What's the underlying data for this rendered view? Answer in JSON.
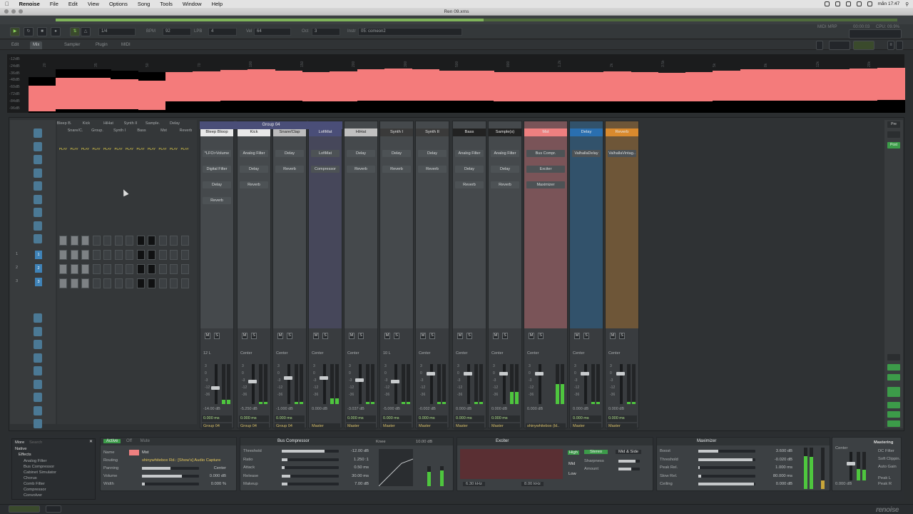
{
  "menu": {
    "app": "Renoise",
    "items": [
      "File",
      "Edit",
      "View",
      "Options",
      "Song",
      "Tools",
      "Window",
      "Help"
    ],
    "clock": "mån 17:47"
  },
  "window": {
    "title": "Ren 09.xrns"
  },
  "transport": {
    "pattern_step": "1/4",
    "bpm_label": "BPM",
    "bpm": "92",
    "lpb_label": "LPB",
    "lpb": "4",
    "vel_label": "Vel",
    "vel": "64",
    "oct_label": "Oct",
    "oct": "3",
    "instr_label": "Instr",
    "instr": "05: comeon2",
    "midi_label": "MIDI MRP",
    "time": "00:00:03",
    "cpu": "CPU: 09.9%"
  },
  "tabs": [
    {
      "label": "Edit"
    },
    {
      "label": "Mix"
    },
    {
      "label": "Sampler"
    },
    {
      "label": "Plugin"
    },
    {
      "label": "MIDI"
    }
  ],
  "spectrum": {
    "db_labels": [
      "-12dB",
      "-24dB",
      "-36dB",
      "-48dB",
      "-60dB",
      "-72dB",
      "-84dB",
      "-96dB"
    ],
    "freq_labels": [
      "20",
      "35",
      "50",
      "70",
      "100",
      "150",
      "200",
      "300",
      "500",
      "800",
      "1.2k",
      "2k",
      "3.5k",
      "5k",
      "8k",
      "12k",
      "20k"
    ],
    "levels": [
      0.78,
      0.52,
      0.52,
      0.56,
      0.62,
      0.6,
      0.58,
      0.53,
      0.5,
      0.55,
      0.6,
      0.58,
      0.52,
      0.49,
      0.5,
      0.55,
      0.57,
      0.6,
      0.62,
      0.6,
      0.62,
      0.58,
      0.61,
      0.64,
      0.62,
      0.56,
      0.5,
      0.52,
      0.5,
      0.52,
      0.49,
      0.47
    ]
  },
  "matrix": {
    "tracks": [
      "Bleep B.",
      "Snare/C.",
      "Kick",
      "Group.",
      "HiHat",
      "Synth I",
      "Synth II",
      "Bass",
      "Sample.",
      "Mst",
      "Delay",
      "Reverb"
    ],
    "play": "PLAY",
    "rows": [
      "1",
      "2",
      "3"
    ]
  },
  "strips": [
    {
      "name": "Group 04",
      "color": "#4a4e78",
      "fx": [],
      "pan": "",
      "vol": "",
      "route": ""
    },
    {
      "name": "Bleep Bloop",
      "color": "#e8e8e8",
      "fx": [
        "*LFO>Volume",
        "Digital Filter",
        "Delay",
        "Reverb"
      ],
      "pan": "12 L",
      "vol": "-14.00 dB",
      "route": "Group 04",
      "lat": "0.000 ms",
      "meter": 0.1,
      "fader": 0.55
    },
    {
      "name": "Kick",
      "color": "#e8e8e8",
      "fx": [
        "Analog Filter",
        "Delay",
        "Reverb"
      ],
      "pan": "Center",
      "vol": "-5.250 dB",
      "route": "Group 04",
      "lat": "0.000 ms",
      "meter": 0.05,
      "fader": 0.4
    },
    {
      "name": "Snare/Clap",
      "color": "#bcbcbc",
      "fx": [
        "Delay",
        "Reverb"
      ],
      "pan": "Center",
      "vol": "-1.000 dB",
      "route": "Group 04",
      "lat": "0.000 ms",
      "meter": 0.05,
      "fader": 0.3
    },
    {
      "name": "LofiMat",
      "color": "#4a4e78",
      "fx": [
        "LofiMat",
        "Compressor"
      ],
      "pan": "Center",
      "vol": "0.000 dB",
      "route": "Master",
      "lat": "",
      "meter": 0.15,
      "fader": 0.3
    },
    {
      "name": "HiHat",
      "color": "#c0c0c0",
      "fx": [
        "Delay",
        "Reverb"
      ],
      "pan": "Center",
      "vol": "-3.037 dB",
      "route": "Master",
      "lat": "0.000 ms",
      "meter": 0.05,
      "fader": 0.35
    },
    {
      "name": "Synth I",
      "color": "#3a3a3a",
      "fx": [
        "Delay",
        "Reverb"
      ],
      "pan": "10 L",
      "vol": "-5.000 dB",
      "route": "Master",
      "lat": "0.000 ms",
      "meter": 0.05,
      "fader": 0.4
    },
    {
      "name": "Synth II",
      "color": "#3a3a3a",
      "fx": [
        "Delay",
        "Reverb"
      ],
      "pan": "Center",
      "vol": "-0.002 dB",
      "route": "Master",
      "lat": "0.000 ms",
      "meter": 0.05,
      "fader": 0.2
    },
    {
      "name": "Bass",
      "color": "#222",
      "fx": [
        "Analog Filter",
        "Delay",
        "Reverb"
      ],
      "pan": "Center",
      "vol": "0.000 dB",
      "route": "Master",
      "lat": "0.000 ms",
      "meter": 0.05,
      "fader": 0.2
    },
    {
      "name": "Sample(s)",
      "color": "#222",
      "fx": [
        "Analog Filter",
        "Delay",
        "Reverb"
      ],
      "pan": "Center",
      "vol": "0.000 dB",
      "route": "Master",
      "lat": "0.000 ms",
      "meter": 0.3,
      "fader": 0.2
    },
    {
      "name": "Mst",
      "color": "#ef8080",
      "fx": [
        "Bus Compr.",
        "Exciter",
        "Maximizer"
      ],
      "pan": "Center",
      "vol": "0.000 dB",
      "route": "shinywhitebox (ld..",
      "lat": "",
      "meter": 0.5,
      "fader": 0.2
    },
    {
      "name": "Delay",
      "color": "#2a6fb0",
      "fx": [
        "ValhallaDelay"
      ],
      "pan": "Center",
      "vol": "0.000 dB",
      "route": "Master",
      "lat": "0.000 ms",
      "meter": 0.05,
      "fader": 0.2
    },
    {
      "name": "Reverb",
      "color": "#d98a2e",
      "fx": [
        "ValhallaVintag.."
      ],
      "pan": "Center",
      "vol": "0.000 dB",
      "route": "Master",
      "lat": "0.000 ms",
      "meter": 0.05,
      "fader": 0.2
    }
  ],
  "browser": {
    "tab": "More",
    "search": "Search",
    "root": "Native",
    "folder": "Effects",
    "items": [
      "Analog Filter",
      "Bus Compressor",
      "Cabinet Simulator",
      "Chorus",
      "Comb Filter",
      "Compressor",
      "Convolver"
    ]
  },
  "track_dev": {
    "tabs": [
      "Active",
      "Off",
      "Mute"
    ],
    "name_label": "Name",
    "name": "Mst",
    "routing_label": "Routing",
    "routing": "shinywhitebox Rd.: [Show's] Audio Capture",
    "panning_label": "Panning",
    "panning": "Center",
    "volume_label": "Volume",
    "volume": "0.000 dB",
    "width_label": "Width",
    "width": "0.000 %"
  },
  "buscomp": {
    "title": "Bus Compressor",
    "params": [
      {
        "l": "Threshold",
        "v": "-12.00 dB",
        "f": 0.75
      },
      {
        "l": "Ratio",
        "v": "1.250 :1",
        "f": 0.1
      },
      {
        "l": "Attack",
        "v": "0.50 ms",
        "f": 0.05
      },
      {
        "l": "Release",
        "v": "30.00 ms",
        "f": 0.15
      },
      {
        "l": "Makeup",
        "v": "7.00 dB",
        "f": 0.1
      }
    ],
    "knee_label": "Knee",
    "knee": "10.00 dB"
  },
  "exciter": {
    "title": "Exciter",
    "mode": "Stereo",
    "mode2": "Mid & Side",
    "bands": [
      "High",
      "Mid",
      "Low"
    ],
    "sharpness_label": "Sharpness",
    "amount_label": "Amount",
    "f1": "6.30 kHz",
    "f2": "8.00 kHz"
  },
  "maximizer": {
    "title": "Maximizer",
    "params": [
      {
        "l": "Boost",
        "v": "3.600 dB",
        "f": 0.35
      },
      {
        "l": "Threshold",
        "v": "-0.020 dB",
        "f": 0.95
      },
      {
        "l": "Peak Rel.",
        "v": "1.000 ms",
        "f": 0.02
      },
      {
        "l": "Slow Rel.",
        "v": "80.000 ms",
        "f": 0.05
      },
      {
        "l": "Ceiling",
        "v": "0.000 dB",
        "f": 0.98
      }
    ]
  },
  "mastering": {
    "title": "Mastering",
    "items": [
      "DC Filter",
      "Soft Clippin.",
      "Auto Gain"
    ],
    "pan": "Center",
    "vol": "0.000 dB",
    "peak_l": "Peak L",
    "peak_r": "Peak R"
  },
  "rightpanel": {
    "pre": "Pre",
    "post": "Post"
  },
  "logo": "renoise",
  "colors": {
    "accent": "#7fb35a",
    "spectrum_fill": "#f47b7b",
    "mst": "#ef8080"
  }
}
